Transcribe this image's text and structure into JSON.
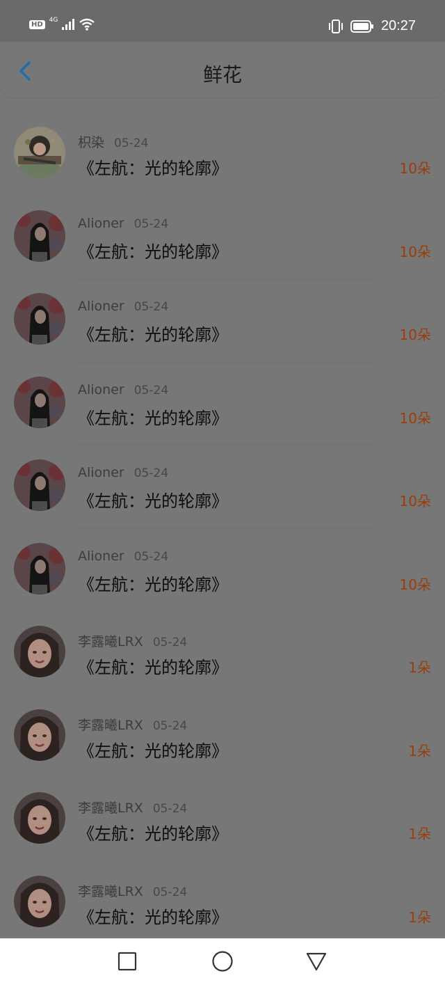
{
  "status_bar": {
    "hd_label": "HD",
    "network_label": "4G",
    "time": "20:27"
  },
  "header": {
    "title": "鲜花",
    "back_icon": "chevron-left-icon",
    "accent_color": "#1f6ea8"
  },
  "list": {
    "amount_color": "#973e0b",
    "items": [
      {
        "name": "枳染",
        "date": "05-24",
        "title": "《左航：光的轮廓》",
        "amount": "10朵",
        "avatar": "illustration"
      },
      {
        "name": "Alioner",
        "date": "05-24",
        "title": "《左航：光的轮廓》",
        "amount": "10朵",
        "avatar": "girl-dark-hair"
      },
      {
        "name": "Alioner",
        "date": "05-24",
        "title": "《左航：光的轮廓》",
        "amount": "10朵",
        "avatar": "girl-dark-hair"
      },
      {
        "name": "Alioner",
        "date": "05-24",
        "title": "《左航：光的轮廓》",
        "amount": "10朵",
        "avatar": "girl-dark-hair"
      },
      {
        "name": "Alioner",
        "date": "05-24",
        "title": "《左航：光的轮廓》",
        "amount": "10朵",
        "avatar": "girl-dark-hair"
      },
      {
        "name": "Alioner",
        "date": "05-24",
        "title": "《左航：光的轮廓》",
        "amount": "10朵",
        "avatar": "girl-dark-hair"
      },
      {
        "name": "李露曦LRX",
        "date": "05-24",
        "title": "《左航：光的轮廓》",
        "amount": "1朵",
        "avatar": "girl-smiling"
      },
      {
        "name": "李露曦LRX",
        "date": "05-24",
        "title": "《左航：光的轮廓》",
        "amount": "1朵",
        "avatar": "girl-smiling"
      },
      {
        "name": "李露曦LRX",
        "date": "05-24",
        "title": "《左航：光的轮廓》",
        "amount": "1朵",
        "avatar": "girl-smiling"
      },
      {
        "name": "李露曦LRX",
        "date": "05-24",
        "title": "《左航：光的轮廓》",
        "amount": "1朵",
        "avatar": "girl-smiling"
      }
    ]
  },
  "nav_bar": {
    "icons": [
      "recent-apps-square-icon",
      "home-circle-icon",
      "back-triangle-icon"
    ]
  }
}
